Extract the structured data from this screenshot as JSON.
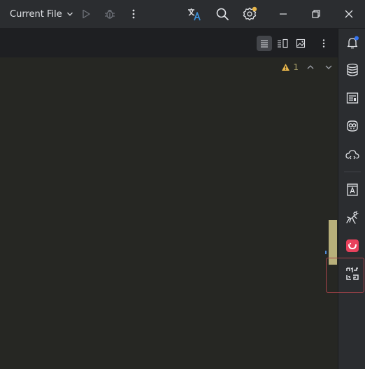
{
  "titlebar": {
    "run_config_label": "Current File",
    "icons": [
      "chevron-down-icon",
      "run-icon",
      "debug-icon",
      "more-vertical-icon",
      "translate-icon",
      "search-icon",
      "settings-icon",
      "minimize-icon",
      "restore-icon",
      "close-icon"
    ]
  },
  "editor_header": {
    "buttons": [
      "code-view-icon",
      "split-view-icon",
      "preview-icon",
      "more-vertical-icon"
    ]
  },
  "editor": {
    "warning_count": "1"
  },
  "rightbar": {
    "icons": [
      "notifications-icon",
      "database-icon",
      "readme-icon",
      "copilot-icon",
      "cloud-code-icon",
      "dictionary-icon",
      "ant-icon",
      "plugin-icon",
      "code-scan-icon"
    ]
  },
  "colors": {
    "accent": "#3574f0",
    "warning": "#e8b64a",
    "highlight_border": "#a8434a"
  }
}
